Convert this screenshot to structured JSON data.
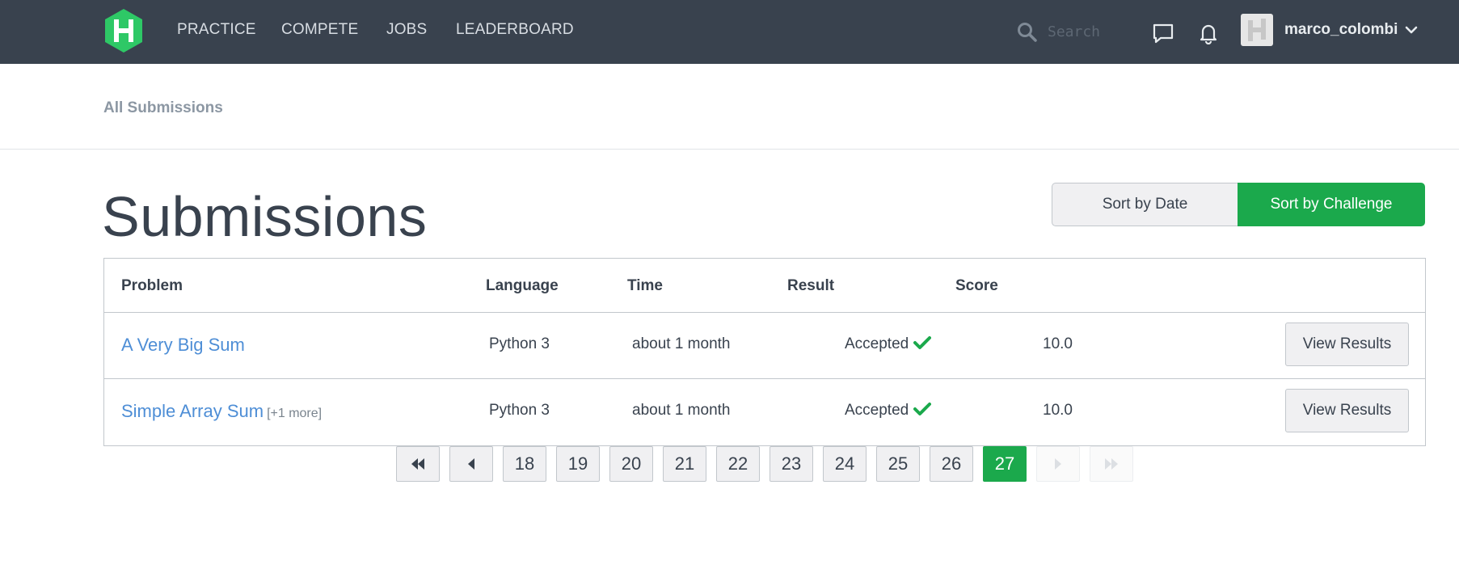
{
  "nav": {
    "items": [
      {
        "label": "PRACTICE"
      },
      {
        "label": "COMPETE"
      },
      {
        "label": "JOBS"
      },
      {
        "label": "LEADERBOARD"
      }
    ],
    "search_placeholder": "Search",
    "username": "marco_colombi",
    "icons": [
      "hackerrank-logo-icon",
      "search-icon",
      "messages-icon",
      "notifications-bell-icon",
      "chevron-down-icon"
    ]
  },
  "breadcrumb": "All Submissions",
  "page": {
    "title": "Submissions",
    "sort_by_date": "Sort by Date",
    "sort_by_challenge": "Sort by Challenge",
    "active_sort": "Sort by Challenge"
  },
  "table": {
    "headers": [
      "Problem",
      "Language",
      "Time",
      "Result",
      "Score"
    ],
    "rows": [
      {
        "problem": "A Very Big Sum",
        "more": "",
        "language": "Python 3",
        "time": "about 1 month",
        "result": "Accepted",
        "score": "10.0",
        "action": "View Results"
      },
      {
        "problem": "Simple Array Sum",
        "more": "[+1 more]",
        "language": "Python 3",
        "time": "about 1 month",
        "result": "Accepted",
        "score": "10.0",
        "action": "View Results"
      }
    ]
  },
  "pagination": {
    "pages": [
      "18",
      "19",
      "20",
      "21",
      "22",
      "23",
      "24",
      "25",
      "26",
      "27"
    ],
    "current": "27"
  },
  "colors": {
    "nav_bg": "#39424e",
    "accent_green": "#1ba94c",
    "link_blue": "#4e8ed6",
    "logo_green": "#2ec866"
  }
}
